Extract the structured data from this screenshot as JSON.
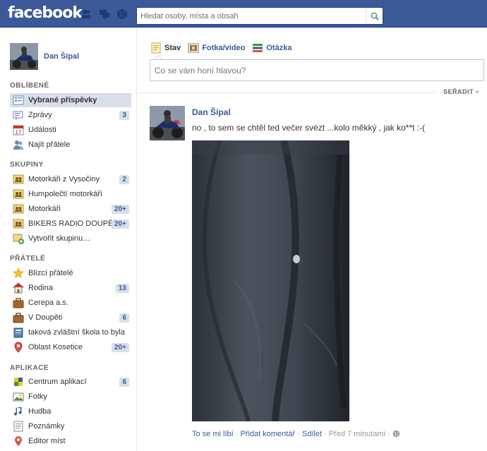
{
  "header": {
    "logo": "facebook",
    "search_placeholder": "Hledat osoby, místa a obsah"
  },
  "user": {
    "name": "Dan Šípal"
  },
  "sidebar": {
    "sections": [
      {
        "title": "OBLÍBENÉ"
      },
      {
        "title": "SKUPINY"
      },
      {
        "title": "PŘÁTELÉ"
      },
      {
        "title": "APLIKACE"
      }
    ],
    "favorites": [
      {
        "label": "Vybrané příspěvky",
        "count": ""
      },
      {
        "label": "Zprávy",
        "count": "3"
      },
      {
        "label": "Události",
        "count": ""
      },
      {
        "label": "Najít přátele",
        "count": ""
      }
    ],
    "groups": [
      {
        "label": "Motorkáři z Vysočiny",
        "count": "2"
      },
      {
        "label": "Humpolečtí motorkáři",
        "count": ""
      },
      {
        "label": "Motorkáři",
        "count": "20+"
      },
      {
        "label": "BIKERS RADIO DOUPĚ",
        "count": "20+"
      },
      {
        "label": "Vytvořit skupinu…",
        "count": ""
      }
    ],
    "friends": [
      {
        "label": "Blízcí přátelé",
        "count": ""
      },
      {
        "label": "Rodina",
        "count": "13"
      },
      {
        "label": "Cerepa a.s.",
        "count": ""
      },
      {
        "label": "V Doupěti",
        "count": "6"
      },
      {
        "label": "taková zvláštní škola to byla",
        "count": ""
      },
      {
        "label": "Oblast Kosetice",
        "count": "20+"
      }
    ],
    "apps": [
      {
        "label": "Centrum aplikací",
        "count": "6"
      },
      {
        "label": "Fotky",
        "count": ""
      },
      {
        "label": "Hudba",
        "count": ""
      },
      {
        "label": "Poznámky",
        "count": ""
      },
      {
        "label": "Editor míst",
        "count": ""
      }
    ]
  },
  "composer": {
    "tabs": [
      "Stav",
      "Fotka/video",
      "Otázka"
    ],
    "placeholder": "Co se vám honí hlavou?"
  },
  "feed": {
    "sort_label": "SEŘADIT",
    "story": {
      "author": "Dan Šípal",
      "text": "no , to sem se chtěl ted večer svézt ...kolo měkký , jak ko**t :-(",
      "actions": [
        "To se mi líbí",
        "Přidat komentář",
        "Sdílet",
        "Před 7 minutami"
      ],
      "separator": " · "
    }
  },
  "colors": {
    "brand": "#3b5998",
    "highlight": "#d8dfea"
  }
}
